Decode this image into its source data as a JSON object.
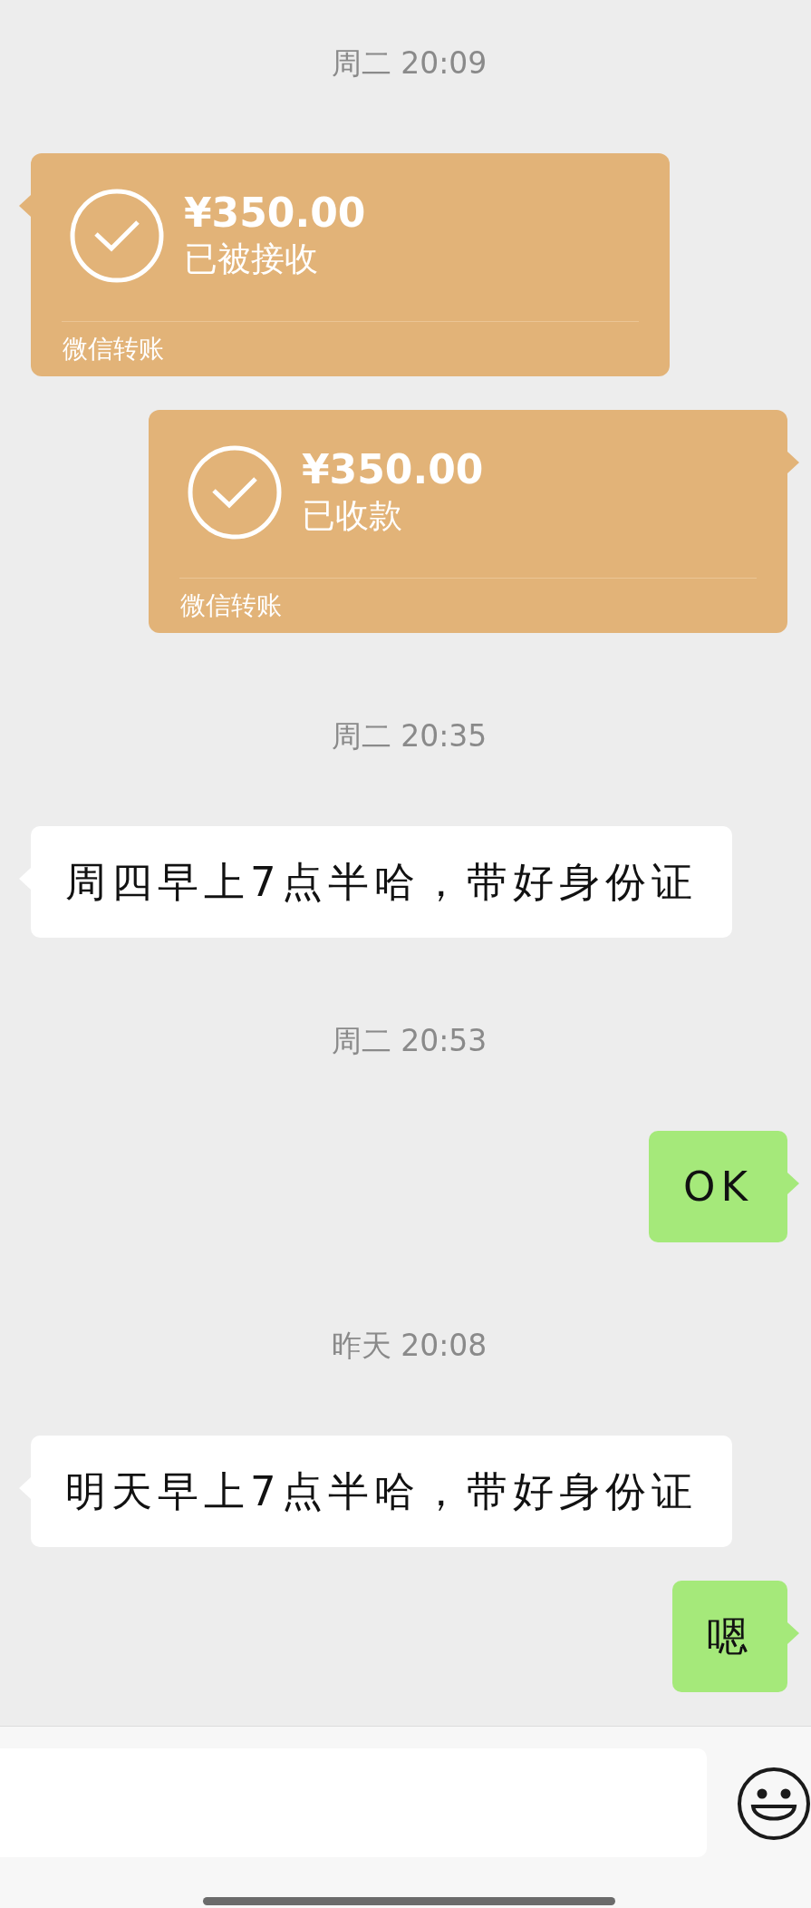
{
  "messages": [
    {
      "kind": "timestamp",
      "text": "周二 20:09"
    },
    {
      "kind": "transfer",
      "outgoing": false,
      "amount": "¥350.00",
      "status": "已被接收",
      "footer": "微信转账"
    },
    {
      "kind": "transfer",
      "outgoing": true,
      "amount": "¥350.00",
      "status": "已收款",
      "footer": "微信转账"
    },
    {
      "kind": "timestamp",
      "text": "周二 20:35"
    },
    {
      "kind": "text",
      "outgoing": false,
      "text": "周四早上7点半哈，带好身份证"
    },
    {
      "kind": "timestamp",
      "text": "周二 20:53"
    },
    {
      "kind": "text",
      "outgoing": true,
      "text": "OK"
    },
    {
      "kind": "timestamp",
      "text": "昨天 20:08"
    },
    {
      "kind": "text",
      "outgoing": false,
      "text": "明天早上7点半哈，带好身份证"
    },
    {
      "kind": "text",
      "outgoing": true,
      "text": "嗯"
    }
  ]
}
